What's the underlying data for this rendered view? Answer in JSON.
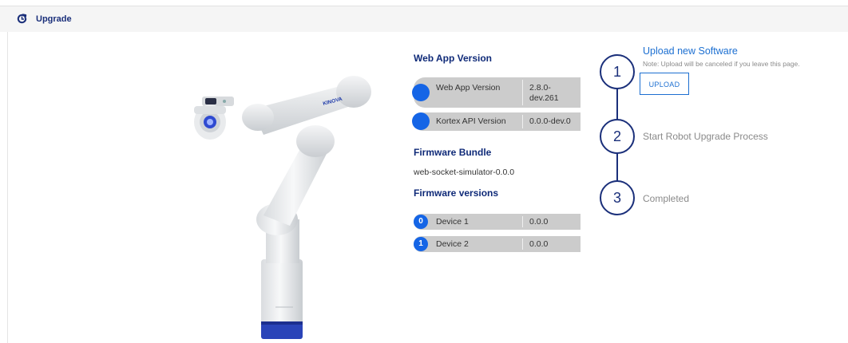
{
  "header": {
    "title": "Upgrade",
    "icon": "refresh-icon"
  },
  "robot": {
    "brand_label": "KINOVA"
  },
  "web_app": {
    "heading": "Web App Version",
    "rows": [
      {
        "label": "Web App Version",
        "value_line1": "2.8.0-",
        "value_line2": "dev.261"
      },
      {
        "label": "Kortex API Version",
        "value": "0.0.0-dev.0"
      }
    ]
  },
  "firmware_bundle": {
    "heading": "Firmware Bundle",
    "value": "web-socket-simulator-0.0.0"
  },
  "firmware_versions": {
    "heading": "Firmware versions",
    "devices": [
      {
        "index": "0",
        "name": "Device 1",
        "version": "0.0.0"
      },
      {
        "index": "1",
        "name": "Device 2",
        "version": "0.0.0"
      }
    ]
  },
  "stepper": {
    "steps": [
      {
        "number": "1",
        "title": "Upload new Software",
        "note": "Note: Upload will be canceled if you leave this page.",
        "button": "UPLOAD"
      },
      {
        "number": "2",
        "title": "Start Robot Upgrade Process"
      },
      {
        "number": "3",
        "title": "Completed"
      }
    ]
  },
  "colors": {
    "accent": "#1c6fd1",
    "navy": "#1a2f7a",
    "dot": "#1565e6",
    "row_bg": "#cccccc"
  }
}
